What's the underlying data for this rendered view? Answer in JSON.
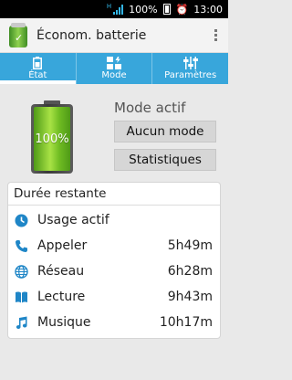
{
  "status_bar": {
    "network": "H",
    "battery_percent": "100%",
    "time": "13:00"
  },
  "app": {
    "title": "Éconоm. batterie"
  },
  "tabs": [
    {
      "label": "État",
      "icon": "battery-icon",
      "selected": true
    },
    {
      "label": "Mode",
      "icon": "mode-icon",
      "selected": false
    },
    {
      "label": "Paramètres",
      "icon": "sliders-icon",
      "selected": false
    }
  ],
  "battery": {
    "level_percent": 100,
    "label": "100%"
  },
  "mode": {
    "label": "Mode actif",
    "current_button": "Aucun mode",
    "stats_button": "Statistiques"
  },
  "remaining": {
    "title": "Durée restante",
    "rows": [
      {
        "icon": "clock-icon",
        "label": "Usage actif",
        "value": ""
      },
      {
        "icon": "phone-icon",
        "label": "Appeler",
        "value": "5h49m"
      },
      {
        "icon": "globe-icon",
        "label": "Réseau",
        "value": "6h28m"
      },
      {
        "icon": "book-icon",
        "label": "Lecture",
        "value": "9h43m"
      },
      {
        "icon": "music-icon",
        "label": "Musique",
        "value": "10h17m"
      }
    ]
  },
  "colors": {
    "accent": "#38a6db",
    "battery_green": "#7cc42b"
  }
}
